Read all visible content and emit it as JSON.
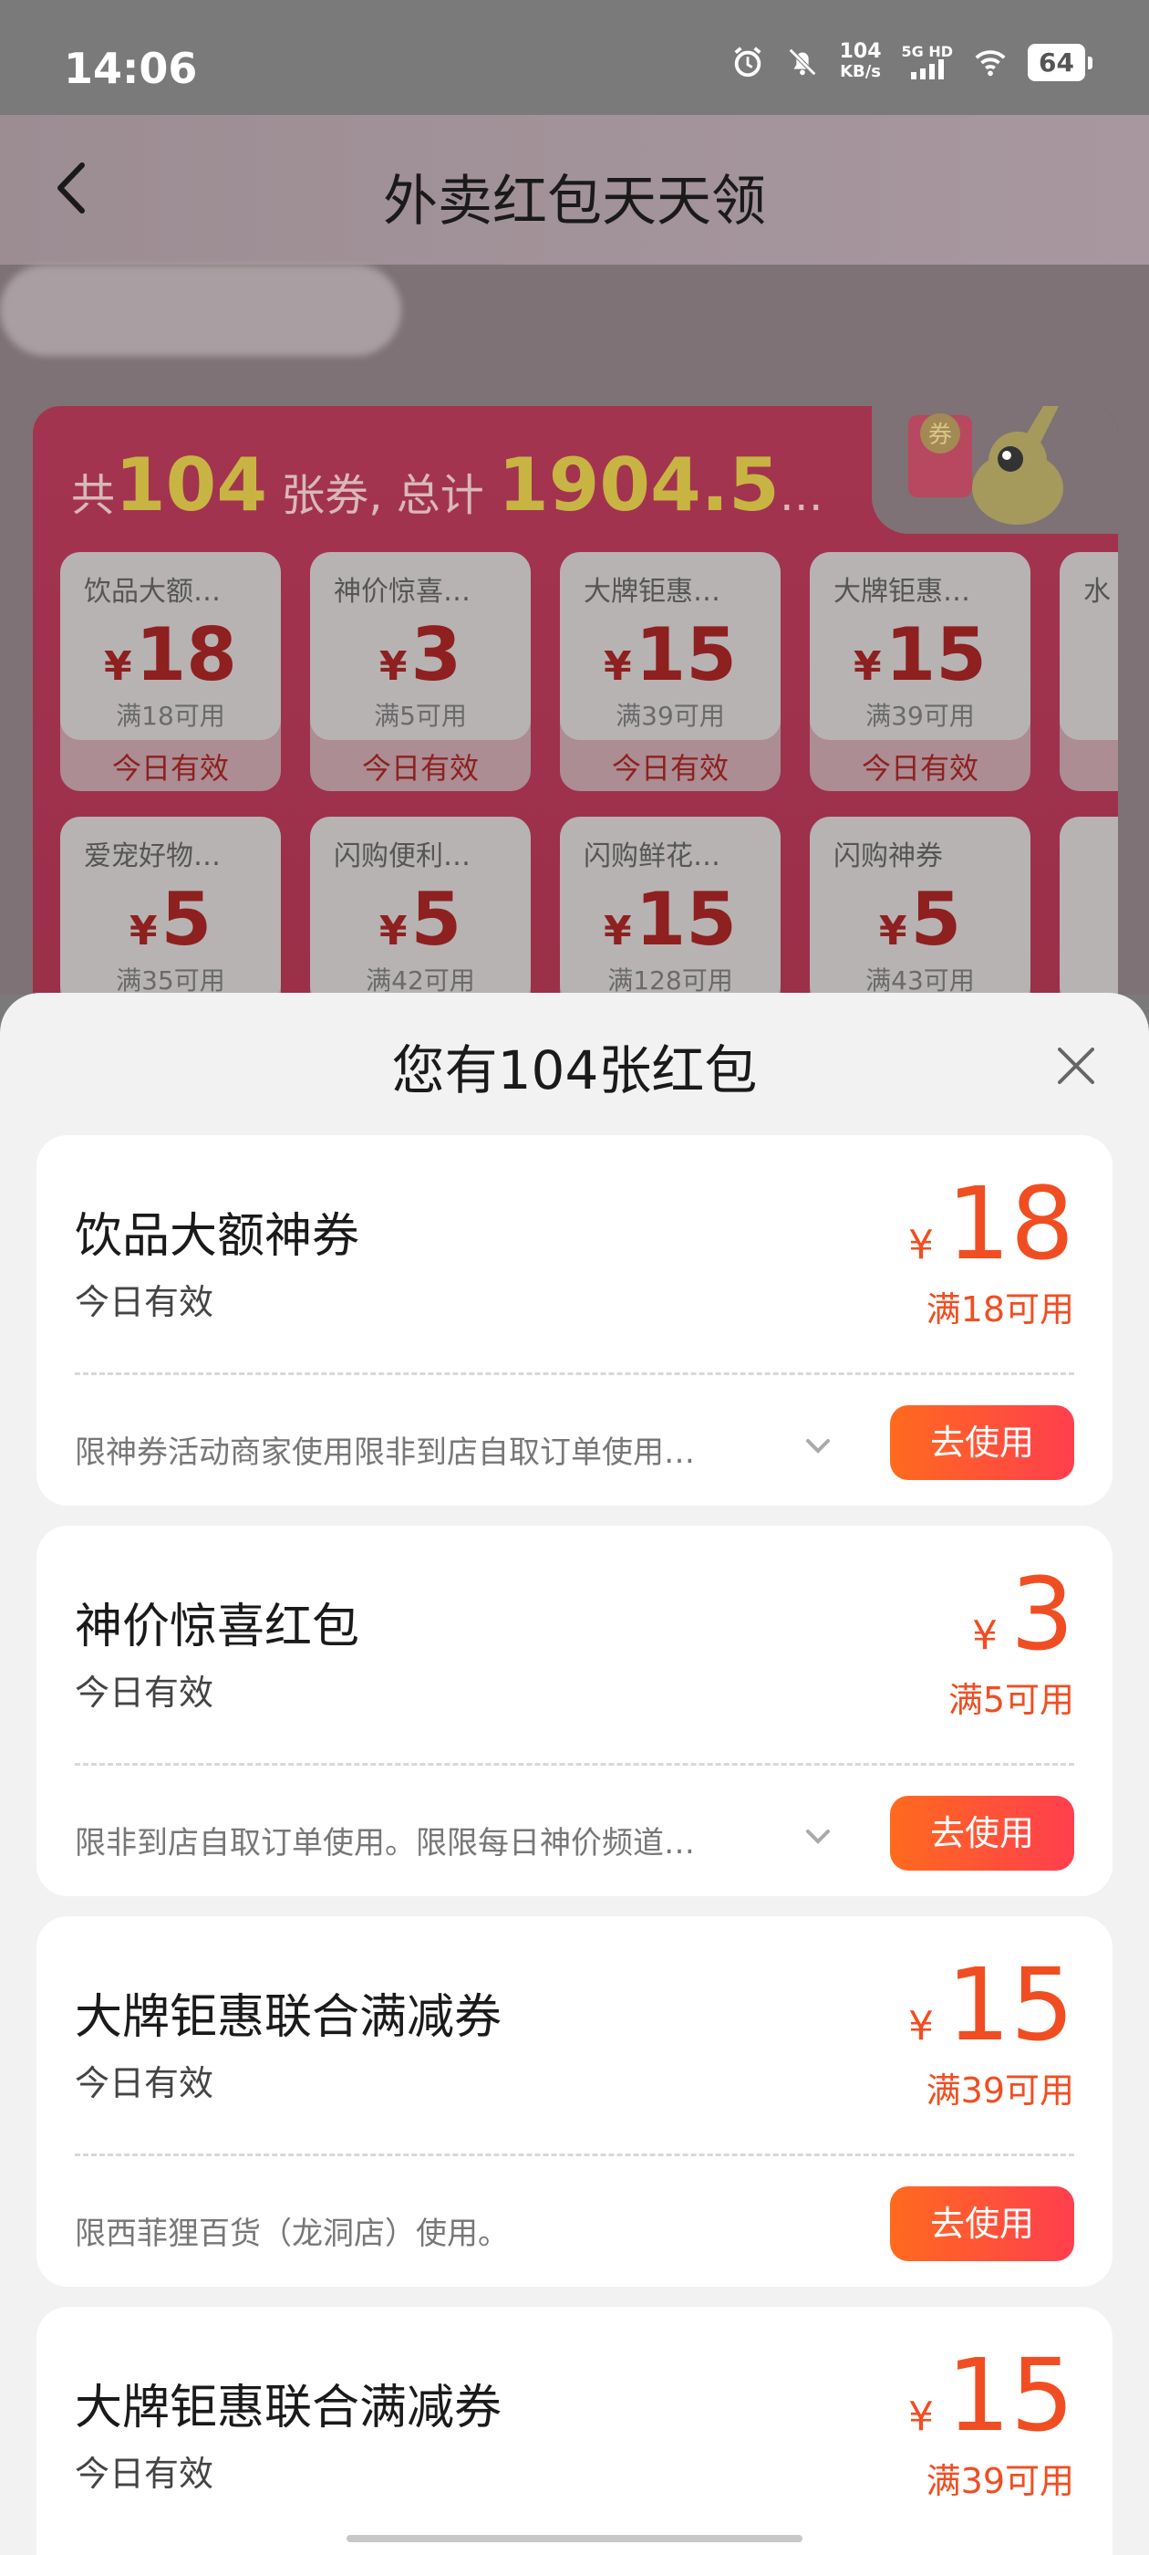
{
  "status_bar": {
    "time": "14:06",
    "speed_value": "104",
    "speed_unit": "KB/s",
    "network": "5G HD",
    "battery": "64",
    "icons": [
      "alarm-icon",
      "mute-bell-icon",
      "signal-icon",
      "wifi-icon",
      "battery-icon"
    ]
  },
  "nav": {
    "title": "外卖红包天天领",
    "back_icon": "chevron-left-icon"
  },
  "panel": {
    "summary_prefix": "共",
    "count": "104",
    "summary_mid": "张券, 总计",
    "total": "1904.5",
    "summary_suffix": "…",
    "mascot_label": "券",
    "coupons": [
      {
        "title": "饮品大额…",
        "amount": "18",
        "cond": "满18可用",
        "valid": "今日有效"
      },
      {
        "title": "神价惊喜…",
        "amount": "3",
        "cond": "满5可用",
        "valid": "今日有效"
      },
      {
        "title": "大牌钜惠…",
        "amount": "15",
        "cond": "满39可用",
        "valid": "今日有效"
      },
      {
        "title": "大牌钜惠…",
        "amount": "15",
        "cond": "满39可用",
        "valid": "今日有效"
      },
      {
        "title": "水",
        "amount": "",
        "cond": "",
        "valid": ""
      },
      {
        "title": "爱宠好物…",
        "amount": "5",
        "cond": "满35可用",
        "valid": ""
      },
      {
        "title": "闪购便利…",
        "amount": "5",
        "cond": "满42可用",
        "valid": ""
      },
      {
        "title": "闪购鲜花…",
        "amount": "15",
        "cond": "满128可用",
        "valid": ""
      },
      {
        "title": "闪购神券",
        "amount": "5",
        "cond": "满43可用",
        "valid": ""
      },
      {
        "title": "",
        "amount": "",
        "cond": "",
        "valid": ""
      }
    ]
  },
  "sheet": {
    "title": "您有104张红包",
    "currency": "¥",
    "use_label": "去使用",
    "cards": [
      {
        "name": "饮品大额神券",
        "valid": "今日有效",
        "amount": "18",
        "cond": "满18可用",
        "desc": "限神券活动商家使用限非到店自取订单使用…",
        "has_chevron": true
      },
      {
        "name": "神价惊喜红包",
        "valid": "今日有效",
        "amount": "3",
        "cond": "满5可用",
        "desc": "限非到店自取订单使用。限限每日神价频道…",
        "has_chevron": true
      },
      {
        "name": "大牌钜惠联合满减券",
        "valid": "今日有效",
        "amount": "15",
        "cond": "满39可用",
        "desc": "限西菲狸百货（龙洞店）使用。",
        "has_chevron": false
      },
      {
        "name": "大牌钜惠联合满减券",
        "valid": "今日有效",
        "amount": "15",
        "cond": "满39可用",
        "desc": "",
        "has_chevron": false
      }
    ]
  }
}
